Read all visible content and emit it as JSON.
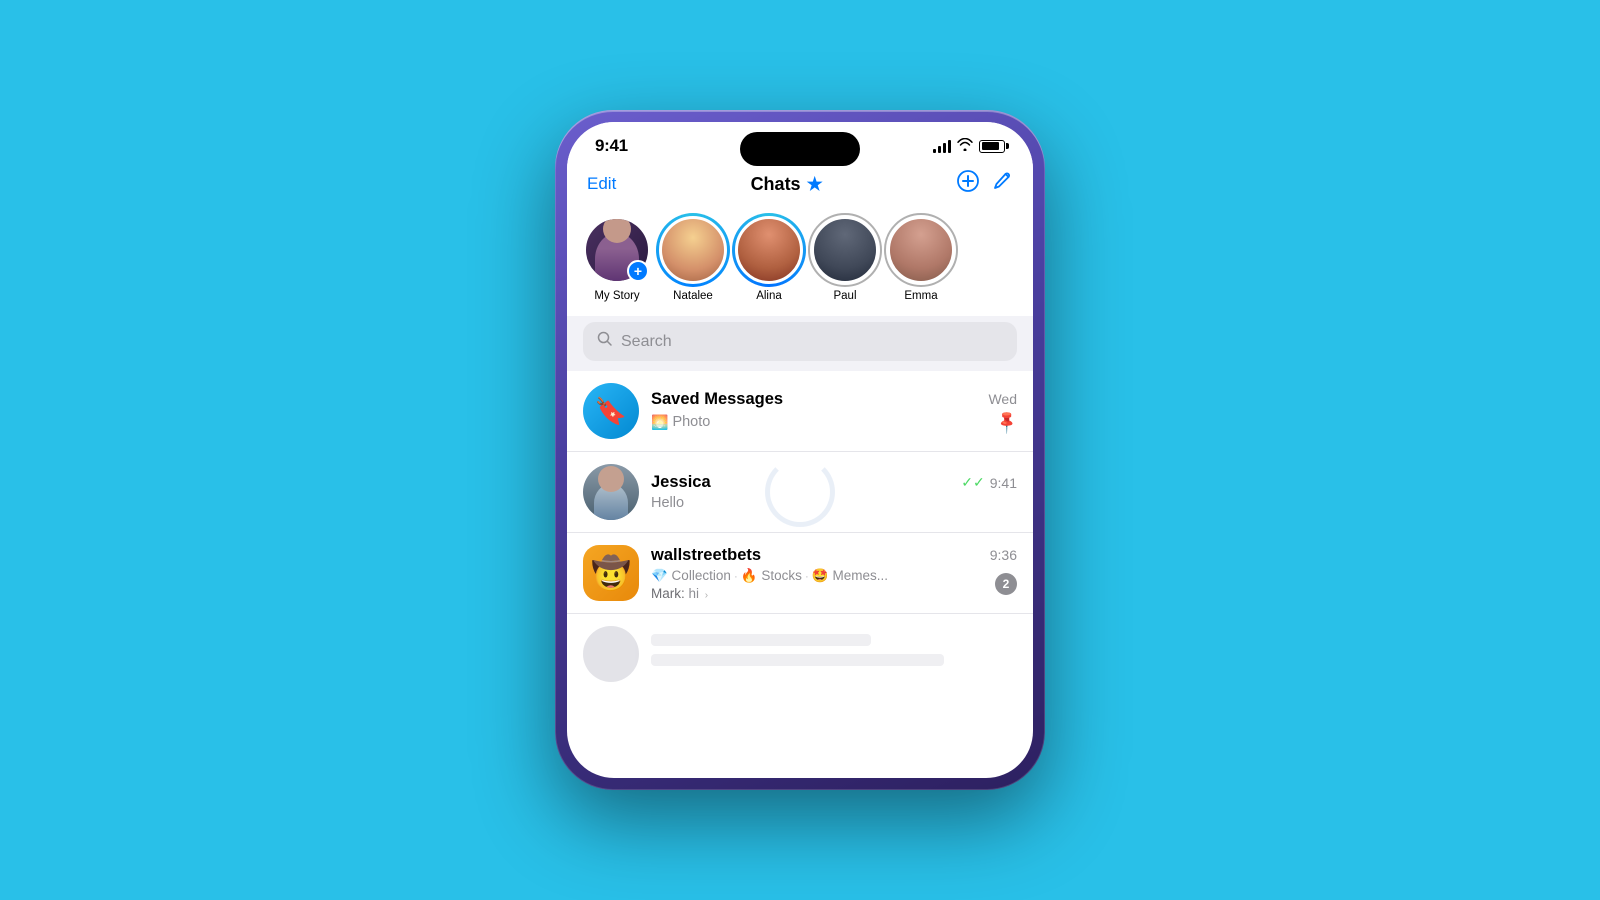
{
  "background": "#29c0e8",
  "statusBar": {
    "time": "9:41",
    "signal": "●●●●",
    "wifi": "wifi",
    "battery": "battery"
  },
  "header": {
    "edit": "Edit",
    "title": "Chats",
    "star": "★",
    "addIcon": "⊕",
    "composeIcon": "✏"
  },
  "stories": [
    {
      "name": "My Story",
      "type": "self"
    },
    {
      "name": "Natalee",
      "type": "unseen"
    },
    {
      "name": "Alina",
      "type": "seen"
    },
    {
      "name": "Paul",
      "type": "seen"
    },
    {
      "name": "Emma",
      "type": "seen"
    }
  ],
  "search": {
    "placeholder": "Search"
  },
  "chats": [
    {
      "id": "saved",
      "name": "Saved Messages",
      "preview": "Photo",
      "time": "Wed",
      "pinned": true,
      "type": "saved"
    },
    {
      "id": "jessica",
      "name": "Jessica",
      "preview": "Hello",
      "time": "9:41",
      "read": true,
      "type": "person"
    },
    {
      "id": "wsb",
      "name": "wallstreetbets",
      "tags": [
        "💎 Collection",
        "🔥 Stocks",
        "🤩 Memes..."
      ],
      "markPreview": "Mark: hi",
      "time": "9:36",
      "badge": "2",
      "type": "group"
    }
  ]
}
